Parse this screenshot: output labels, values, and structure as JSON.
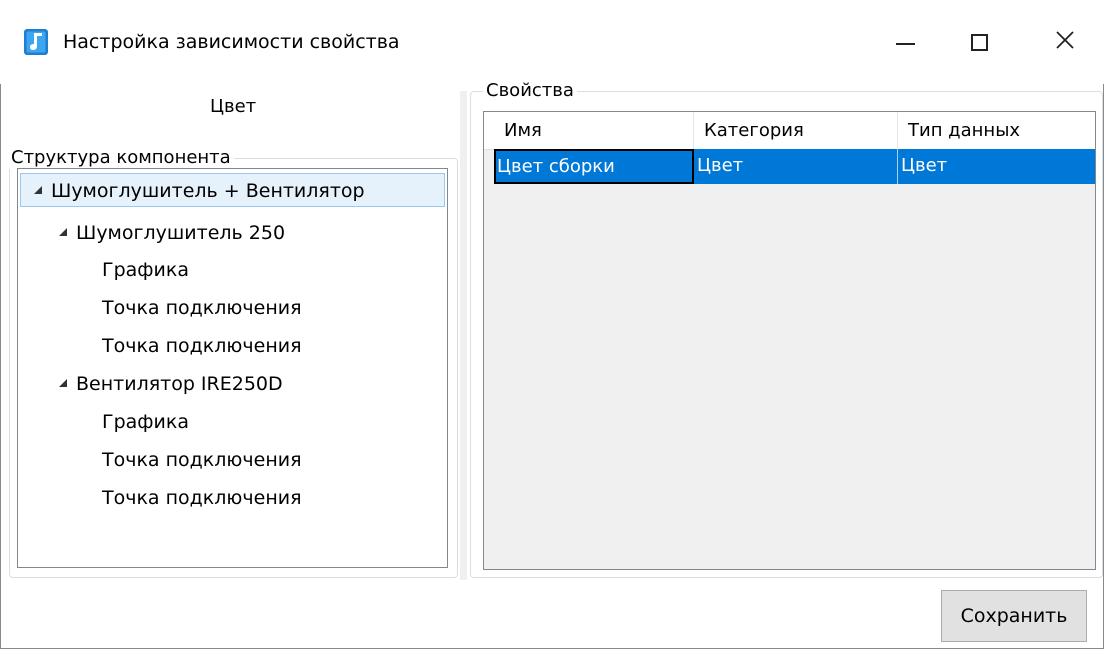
{
  "window": {
    "title": "Настройка зависимости свойства",
    "icon": "app-logo-icon",
    "controls": [
      "minimize-icon",
      "maximize-icon",
      "close-icon"
    ]
  },
  "property_name": "Цвет",
  "structure": {
    "legend": "Структура компонента",
    "items": [
      {
        "label": "Шумоглушитель + Вентилятор",
        "level": 0,
        "expanded": true,
        "selected": true
      },
      {
        "label": "Шумоглушитель 250",
        "level": 1,
        "expanded": true
      },
      {
        "label": "Графика",
        "level": 2
      },
      {
        "label": "Точка подключения",
        "level": 2
      },
      {
        "label": "Точка подключения",
        "level": 2
      },
      {
        "label": "Вентилятор IRE250D",
        "level": 1,
        "expanded": true
      },
      {
        "label": "Графика",
        "level": 2
      },
      {
        "label": "Точка подключения",
        "level": 2
      },
      {
        "label": "Точка подключения",
        "level": 2
      }
    ]
  },
  "properties": {
    "legend": "Свойства",
    "columns": [
      "Имя",
      "Категория",
      "Тип данных"
    ],
    "rows": [
      {
        "name": "Цвет сборки",
        "category": "Цвет",
        "type": "Цвет",
        "selected": true
      }
    ]
  },
  "buttons": {
    "save": "Сохранить"
  },
  "colors": {
    "selection": "#0078d7",
    "tree_selection": "#e5f1fb",
    "button_face": "#e1e1e1"
  }
}
